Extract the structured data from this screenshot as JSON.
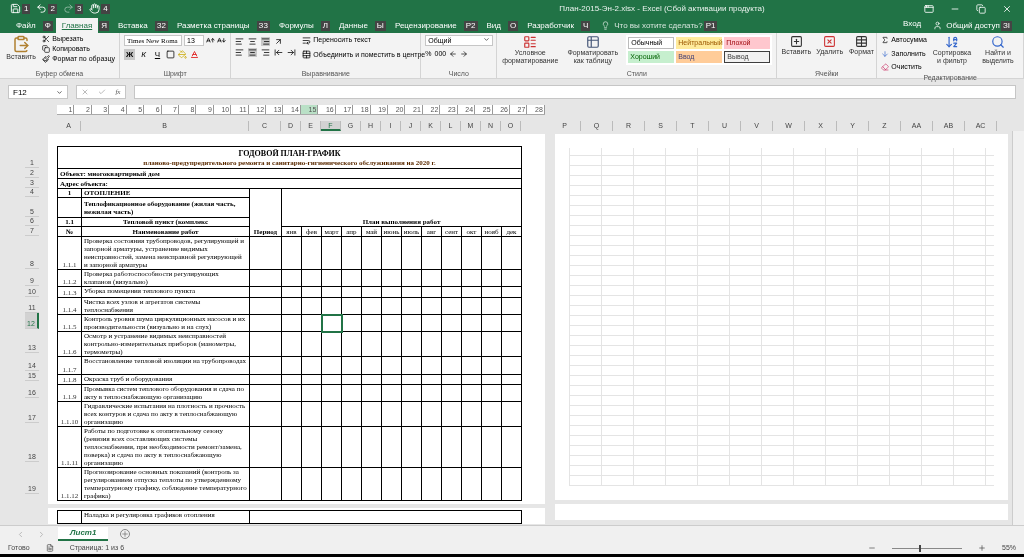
{
  "title_bar": {
    "title": "План-2015-Эн-2.xlsx - Excel (Сбой активации продукта)",
    "quick_access": [
      {
        "kind": "save",
        "keytip": "1"
      },
      {
        "kind": "undo",
        "keytip": "2"
      },
      {
        "kind": "redo",
        "keytip": "3"
      },
      {
        "kind": "touch",
        "keytip": "4"
      }
    ]
  },
  "tabs": [
    {
      "label": "Файл",
      "selected": false,
      "keytip": "Ф"
    },
    {
      "label": "Главная",
      "selected": true,
      "keytip": "Я"
    },
    {
      "label": "Вставка",
      "selected": false,
      "keytip": "З2"
    },
    {
      "label": "Разметка страницы",
      "selected": false,
      "keytip": "З3"
    },
    {
      "label": "Формулы",
      "selected": false,
      "keytip": "Л"
    },
    {
      "label": "Данные",
      "selected": false,
      "keytip": "Ы"
    },
    {
      "label": "Рецензирование",
      "selected": false,
      "keytip": "Р2"
    },
    {
      "label": "Вид",
      "selected": false,
      "keytip": "О"
    },
    {
      "label": "Разработчик",
      "selected": false,
      "keytip": "Ч"
    }
  ],
  "tell_me": {
    "placeholder": "Что вы хотите сделать?",
    "keytip": "Р1"
  },
  "account": {
    "sign_in": "Вход",
    "share": "Общий доступ",
    "share_keytip": "ЗІ"
  },
  "ribbon": {
    "clipboard": {
      "paste": "Вставить",
      "cut": "Вырезать",
      "copy": "Копировать",
      "format_painter": "Формат по образцу",
      "label": "Буфер обмена"
    },
    "font": {
      "name": "Times New Roma",
      "size": "13",
      "bold": {
        "label": "Ж",
        "on": true
      },
      "italic": {
        "label": "К",
        "on": false
      },
      "underline": {
        "label": "Ч",
        "on": false
      },
      "label": "Шрифт"
    },
    "alignment": {
      "wrap": "Переносить текст",
      "merge": "Объединить и поместить в центре",
      "label": "Выравнивание"
    },
    "number": {
      "format": "Общий",
      "percent": "%",
      "thousands": "000",
      "label": "Число"
    },
    "styles": {
      "conditional": "Условное форматирование",
      "as_table": "Форматировать как таблицу",
      "gallery": [
        {
          "label": "Обычный",
          "kind": "normal"
        },
        {
          "label": "Нейтральный",
          "kind": "neutral"
        },
        {
          "label": "Плохой",
          "kind": "bad"
        },
        {
          "label": "Хороший",
          "kind": "good"
        },
        {
          "label": "Ввод",
          "kind": "input"
        },
        {
          "label": "Вывод",
          "kind": "output"
        }
      ],
      "label": "Стили"
    },
    "cells": {
      "insert": "Вставить",
      "delete": "Удалить",
      "format": "Формат",
      "label": "Ячейки"
    },
    "editing": {
      "autosum": "Автосумма",
      "fill": "Заполнить",
      "clear": "Очистить",
      "sort": "Сортировка и фильтр",
      "find": "Найти и выделить",
      "label": "Редактирование"
    }
  },
  "formula_bar": {
    "name_box": "F12",
    "fx": "fx"
  },
  "ruler": [
    {
      "label": "1",
      "selected": false
    },
    {
      "label": "2",
      "selected": false
    },
    {
      "label": "3",
      "selected": false
    },
    {
      "label": "4",
      "selected": false
    },
    {
      "label": "5",
      "selected": false
    },
    {
      "label": "6",
      "selected": false
    },
    {
      "label": "7",
      "selected": false
    },
    {
      "label": "8",
      "selected": false
    },
    {
      "label": "9",
      "selected": false
    },
    {
      "label": "10",
      "selected": false
    },
    {
      "label": "11",
      "selected": false
    },
    {
      "label": "12",
      "selected": false
    },
    {
      "label": "13",
      "selected": false
    },
    {
      "label": "14",
      "selected": false
    },
    {
      "label": "15",
      "selected": true
    },
    {
      "label": "16",
      "selected": false
    },
    {
      "label": "17",
      "selected": false
    },
    {
      "label": "18",
      "selected": false
    },
    {
      "label": "19",
      "selected": false
    },
    {
      "label": "20",
      "selected": false
    },
    {
      "label": "21",
      "selected": false
    },
    {
      "label": "22",
      "selected": false
    },
    {
      "label": "23",
      "selected": false
    },
    {
      "label": "24",
      "selected": false
    },
    {
      "label": "25",
      "selected": false
    },
    {
      "label": "26",
      "selected": false
    },
    {
      "label": "27",
      "selected": false
    },
    {
      "label": "28",
      "selected": false
    }
  ],
  "columns": [
    {
      "label": "A",
      "selected": false
    },
    {
      "label": "B",
      "selected": false
    },
    {
      "label": "C",
      "selected": false
    },
    {
      "label": "D",
      "selected": false
    },
    {
      "label": "E",
      "selected": false
    },
    {
      "label": "F",
      "selected": true
    },
    {
      "label": "G",
      "selected": false
    },
    {
      "label": "H",
      "selected": false
    },
    {
      "label": "I",
      "selected": false
    },
    {
      "label": "J",
      "selected": false
    },
    {
      "label": "K",
      "selected": false
    },
    {
      "label": "L",
      "selected": false
    },
    {
      "label": "M",
      "selected": false
    },
    {
      "label": "N",
      "selected": false
    },
    {
      "label": "O",
      "selected": false
    }
  ],
  "columns_page_2": [
    "P",
    "Q",
    "R",
    "S",
    "T",
    "U",
    "V",
    "W",
    "X",
    "Y",
    "Z",
    "AA",
    "AB",
    "AC"
  ],
  "row_headers": [
    {
      "label": "1",
      "selected": false
    },
    {
      "label": "2",
      "selected": false
    },
    {
      "label": "3",
      "selected": false
    },
    {
      "label": "4",
      "selected": false
    },
    {
      "label": "5",
      "selected": false
    },
    {
      "label": "6",
      "selected": false
    },
    {
      "label": "7",
      "selected": false
    },
    {
      "label": "8",
      "selected": false
    },
    {
      "label": "9",
      "selected": false
    },
    {
      "label": "10",
      "selected": false
    },
    {
      "label": "11",
      "selected": false
    },
    {
      "label": "12",
      "selected": true
    },
    {
      "label": "13",
      "selected": false
    },
    {
      "label": "14",
      "selected": false
    },
    {
      "label": "15",
      "selected": false
    },
    {
      "label": "16",
      "selected": false
    },
    {
      "label": "17",
      "selected": false
    },
    {
      "label": "18",
      "selected": false
    },
    {
      "label": "19",
      "selected": false
    }
  ],
  "table": {
    "title": "ГОДОВОЙ ПЛАН-ГРАФИК",
    "subtitle": "планово-предупредительного ремонта и санитарно-гигиенического обслуживания на 2020 г.",
    "object": "Объект: многоквартирный дом",
    "address": "Адрес объекта:",
    "section_number": "1",
    "section": "ОТОПЛЕНИЕ",
    "subsection": "Теплофикационное оборудование (жилая часть, нежилая часть)",
    "unit_number": "1.1",
    "unit": "Тепловой пункт (комплекс",
    "plan_header": "План выполнения работ",
    "number_header": "№",
    "work_header": "Наименование работ",
    "period_header": "Период",
    "months": [
      "янв",
      "фев",
      "март",
      "апр",
      "май",
      "июнь",
      "июль",
      "авг",
      "сент",
      "окт",
      "нояб",
      "дек"
    ],
    "rows": [
      {
        "number": "1.1.1",
        "work": "Проверка состояния трубопроводов, регулирующей и запорной арматуры, устранение видимых неисправностей, замена неисправной регулирующей и запорной арматуры",
        "selected": false
      },
      {
        "number": "1.1.2",
        "work": "Проверка работоспособности регулирующих клапанов (визуально)",
        "selected": false
      },
      {
        "number": "1.1.3",
        "work": "Уборка помещения теплового пункта",
        "selected": false
      },
      {
        "number": "1.1.4",
        "work": "Чистка всех узлов и агрегатов системы теплоснабжения",
        "selected": false
      },
      {
        "number": "1.1.5",
        "work": "Контроль уровня шума циркуляционных насосов и их производительности (визуально и на слух)",
        "selected": true
      },
      {
        "number": "1.1.6",
        "work": "Осмотр и устранение видимых неисправностей контрольно-измерительных приборов (манометры, термометры)",
        "selected": false
      },
      {
        "number": "1.1.7",
        "work": "Восстановление тепловой изоляции на трубопроводах",
        "selected": false
      },
      {
        "number": "1.1.8",
        "work": "Окраска труб и оборудования",
        "selected": false
      },
      {
        "number": "1.1.9",
        "work": "Промывка систем теплового оборудования и сдача по акту в теплоснабжающую организацию",
        "selected": false
      },
      {
        "number": "1.1.10",
        "work": "Гидравлические испытания на плотность и прочность всех контуров и сдача по акту в теплоснабжающую организацию",
        "selected": false
      },
      {
        "number": "1.1.11",
        "work": "Работы по подготовке к отопительному сезону (ревизия всех составляющих системы теплоснабжения, при необходимости ремонт/замена, поверка) и сдача по акту в теплоснабжающую организацию",
        "selected": false
      },
      {
        "number": "1.1.12",
        "work": "Прогнозирование основных показаний (контроль за регулированием отпуска теплоты по утвержденному температурному графику, соблюдение температурного графика)",
        "selected": false
      }
    ],
    "next_page_row": "Наладка и регулировка графиков отопления"
  },
  "sheet_tabs": [
    {
      "label": "Лист1",
      "selected": true
    }
  ],
  "status_bar": {
    "state": "Готово",
    "page": "Страница: 1 из 6",
    "zoom": "55%",
    "zoom_slider": {
      "level": 0.4
    }
  }
}
